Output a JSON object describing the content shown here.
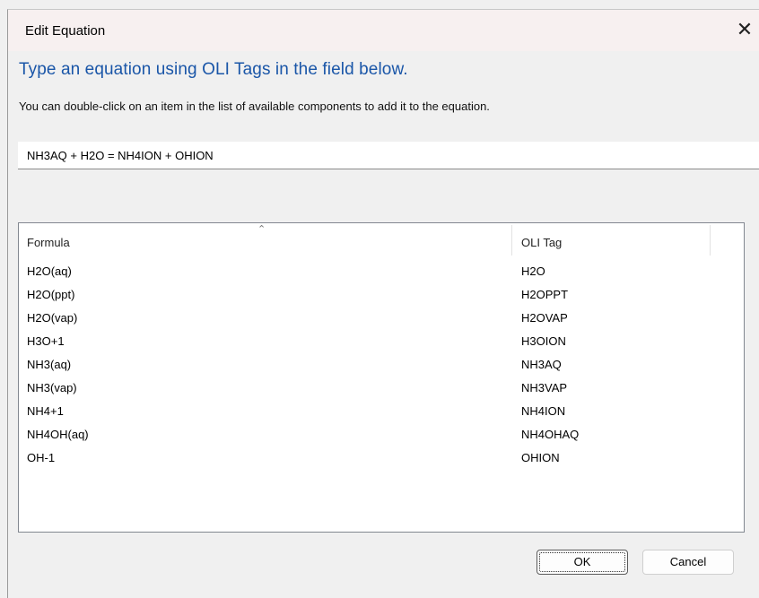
{
  "window": {
    "title": "Edit Equation",
    "close_glyph": "✕"
  },
  "heading": "Type an equation using OLI Tags in the field below.",
  "subtext": "You can double-click on an item in the list of available components to add it to the equation.",
  "equation": {
    "value": "NH3AQ + H2O = NH4ION + OHION",
    "placeholder": ""
  },
  "list": {
    "sort_icon": "sort-ascending-icon",
    "columns": [
      "Formula",
      "OLI Tag"
    ],
    "rows": [
      {
        "formula": "H2O(aq)",
        "tag": "H2O"
      },
      {
        "formula": "H2O(ppt)",
        "tag": "H2OPPT"
      },
      {
        "formula": "H2O(vap)",
        "tag": "H2OVAP"
      },
      {
        "formula": "H3O+1",
        "tag": "H3OION"
      },
      {
        "formula": "NH3(aq)",
        "tag": "NH3AQ"
      },
      {
        "formula": "NH3(vap)",
        "tag": "NH3VAP"
      },
      {
        "formula": "NH4+1",
        "tag": "NH4ION"
      },
      {
        "formula": "NH4OH(aq)",
        "tag": "NH4OHAQ"
      },
      {
        "formula": "OH-1",
        "tag": "OHION"
      }
    ]
  },
  "buttons": {
    "ok": "OK",
    "cancel": "Cancel"
  },
  "colors": {
    "heading": "#1a56a8",
    "titlebar": "#f7f0f0",
    "background": "#f0f0f0"
  }
}
